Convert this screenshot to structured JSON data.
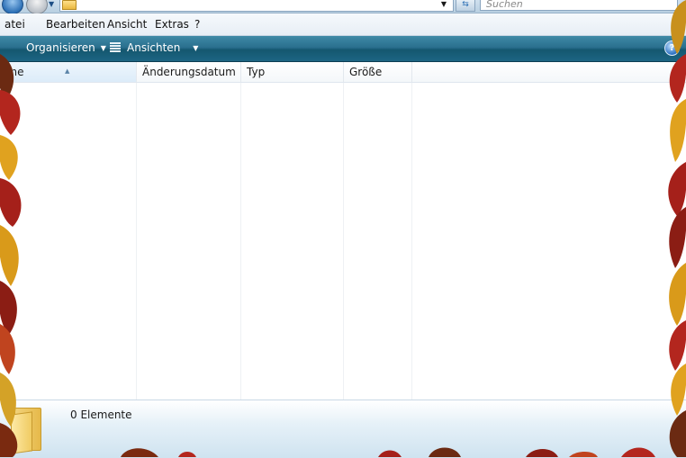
{
  "address_bar": {
    "search_placeholder": "Suchen"
  },
  "menu": {
    "items": [
      "atei",
      "Bearbeiten",
      "Ansicht",
      "Extras",
      "?"
    ]
  },
  "command_bar": {
    "organize_label": "Organisieren",
    "views_label": "Ansichten"
  },
  "columns": {
    "name": "eme",
    "date": "Änderungsdatum",
    "type": "Typ",
    "size": "Größe"
  },
  "status": {
    "count_label": "0 Elemente"
  },
  "colors": {
    "command_bar": "#2a6f8e",
    "accent": "#2c6fb5",
    "leaf_red": "#b3261e",
    "leaf_yellow": "#e0a21f",
    "leaf_brown": "#6b2a12"
  }
}
